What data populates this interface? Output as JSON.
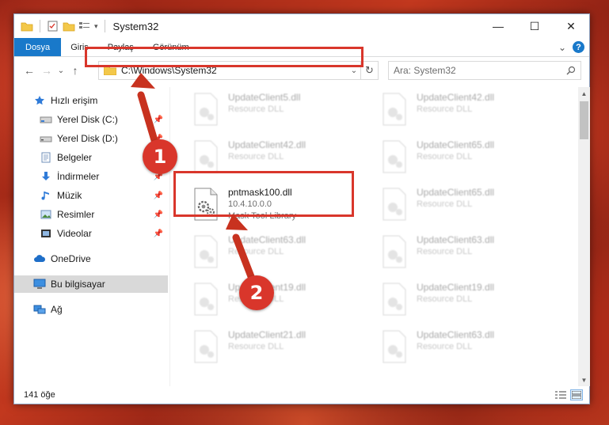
{
  "window": {
    "title": "System32",
    "controls": {
      "minimize": "—",
      "maximize": "☐",
      "close": "✕"
    }
  },
  "ribbon": {
    "tabs": [
      "Dosya",
      "Giriş",
      "Paylaş",
      "Görünüm"
    ],
    "expand": "⌄",
    "help": "?"
  },
  "nav": {
    "back": "←",
    "forward": "→",
    "recent": "⌄",
    "up": "↑"
  },
  "address": {
    "path": "C:\\Windows\\System32",
    "dropdown": "⌄",
    "refresh": "↻"
  },
  "search": {
    "placeholder": "Ara: System32",
    "icon": "search-icon"
  },
  "sidebar": {
    "items": [
      {
        "label": "Hızlı erişim",
        "icon": "star-icon",
        "pinned": false
      },
      {
        "label": "Yerel Disk (C:)",
        "icon": "drive-icon",
        "pinned": true
      },
      {
        "label": "Yerel Disk (D:)",
        "icon": "drive-icon",
        "pinned": true
      },
      {
        "label": "Belgeler",
        "icon": "documents-icon",
        "pinned": true
      },
      {
        "label": "İndirmeler",
        "icon": "download-icon",
        "pinned": true
      },
      {
        "label": "Müzik",
        "icon": "music-icon",
        "pinned": true
      },
      {
        "label": "Resimler",
        "icon": "pictures-icon",
        "pinned": true
      },
      {
        "label": "Videolar",
        "icon": "videos-icon",
        "pinned": true
      },
      {
        "label": "OneDrive",
        "icon": "cloud-icon",
        "pinned": false
      },
      {
        "label": "Bu bilgisayar",
        "icon": "computer-icon",
        "pinned": false,
        "selected": true
      },
      {
        "label": "Ağ",
        "icon": "network-icon",
        "pinned": false
      }
    ]
  },
  "files": {
    "left_column": [
      {
        "name": "UpdateClient5.dll",
        "sub": "Resource DLL",
        "blurred": true
      },
      {
        "name": "UpdateClient42.dll",
        "sub": "Resource DLL",
        "blurred": true
      },
      {
        "name": "pntmask100.dll",
        "version": "10.4.10.0.0",
        "description": "Mask Tool Library",
        "blurred": false
      },
      {
        "name": "UpdateClient63.dll",
        "sub": "Resource DLL",
        "blurred": true
      },
      {
        "name": "UpdateClient19.dll",
        "sub": "Resource DLL",
        "blurred": true
      },
      {
        "name": "UpdateClient21.dll",
        "sub": "Resource DLL",
        "blurred": true
      }
    ],
    "right_column": [
      {
        "name": "UpdateClient42.dll",
        "sub": "Resource DLL",
        "blurred": true
      },
      {
        "name": "UpdateClient65.dll",
        "sub": "Resource DLL",
        "blurred": true
      },
      {
        "name": "UpdateClient65.dll",
        "sub": "Resource DLL",
        "blurred": true
      },
      {
        "name": "UpdateClient63.dll",
        "sub": "Resource DLL",
        "blurred": true
      },
      {
        "name": "UpdateClient19.dll",
        "sub": "Resource DLL",
        "blurred": true
      },
      {
        "name": "UpdateClient63.dll",
        "sub": "Resource DLL",
        "blurred": true
      }
    ]
  },
  "status": {
    "count": "141 öğe"
  },
  "annotations": {
    "step1": "1",
    "step2": "2",
    "color": "#d9362b"
  },
  "colors": {
    "accent": "#1979ca",
    "highlight": "#d9362b"
  }
}
